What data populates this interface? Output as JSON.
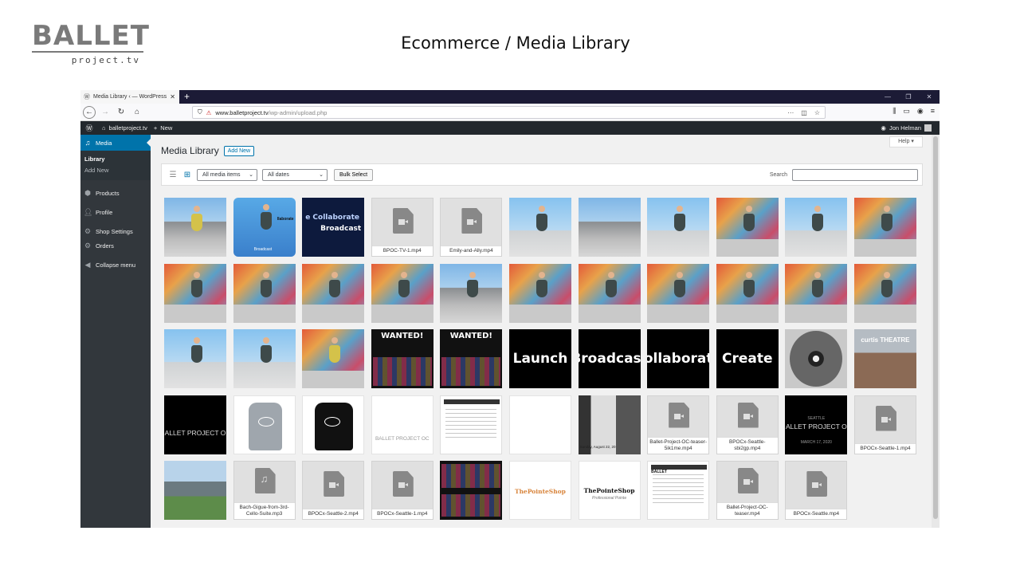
{
  "slide": {
    "logo_word": "BALLET",
    "logo_sub": "project.tv",
    "title": "Ecommerce / Media Library"
  },
  "browser": {
    "tab_title": "Media Library ‹ — WordPress",
    "tab_close": "✕",
    "new_tab": "+",
    "url_host": "www.balletproject.tv",
    "url_path": "/wp-admin/upload.php",
    "url_menu": "···"
  },
  "adminbar": {
    "site_name": "balletproject.tv",
    "new_label": "New",
    "user_name": "Jon Helman"
  },
  "sidebar": {
    "media": "Media",
    "library": "Library",
    "add_new": "Add New",
    "products": "Products",
    "profile": "Profile",
    "shop_settings": "Shop Settings",
    "orders": "Orders",
    "collapse": "Collapse menu"
  },
  "main": {
    "help": "Help ▾",
    "title": "Media Library",
    "add_new": "Add New",
    "filter_type": "All media items",
    "filter_date": "All dates",
    "bulk_select": "Bulk Select",
    "search_label": "Search"
  },
  "media": {
    "r1_blue_text1": "llaborate",
    "r1_blue_text2": "Broadcast",
    "r1_navy_text1": "e Collaborate",
    "r1_navy_text2": "Broadcast",
    "v1": "BPOC-TV-1.mp4",
    "v2": "Emily-and-Ally.mp4",
    "wanted1": "WANTED!",
    "wanted2": "WANTED!",
    "launch": "Launch",
    "broadcast": "Broadcast",
    "collaborate": "ollaborat",
    "create": "Create",
    "theatre": "curtis THEATRE",
    "blk_logo": "ALLET PROJECT O",
    "bpoc_logo": "BALLET PROJECT OC",
    "pointe_a_date": "Sunday, August 22, 20",
    "v3": "Ballet-Project-OC-teaser-5ik1me.mp4",
    "v4": "BPOCx-Seattle-sbi2gp.mp4",
    "seattle_top": "SEATTLE",
    "seattle_logo": "ALLET PROJECT O",
    "seattle_date": "MARCH 17, 2020",
    "v5": "BPOCx-Seattle-1.mp4",
    "a1": "Bach-Gigue-from-3rd-Cello-Suite.mp3",
    "v6": "BPOCx-Seattle-2.mp4",
    "v7": "BPOCx-Seattle-1.mp4",
    "pointe_shop": "ThePointeShop",
    "pointe_shop2": "ThePointeShop",
    "pointe_sub": "Professional Pointe",
    "doc_title": "BALLET",
    "v8": "Ballet-Project-OC-teaser.mp4",
    "v9": "BPOCx-Seattle.mp4"
  },
  "colors": {
    "admin_bar": "#23282d",
    "sidebar": "#32373c",
    "active": "#0073aa",
    "tabbar": "#1c1b36"
  }
}
